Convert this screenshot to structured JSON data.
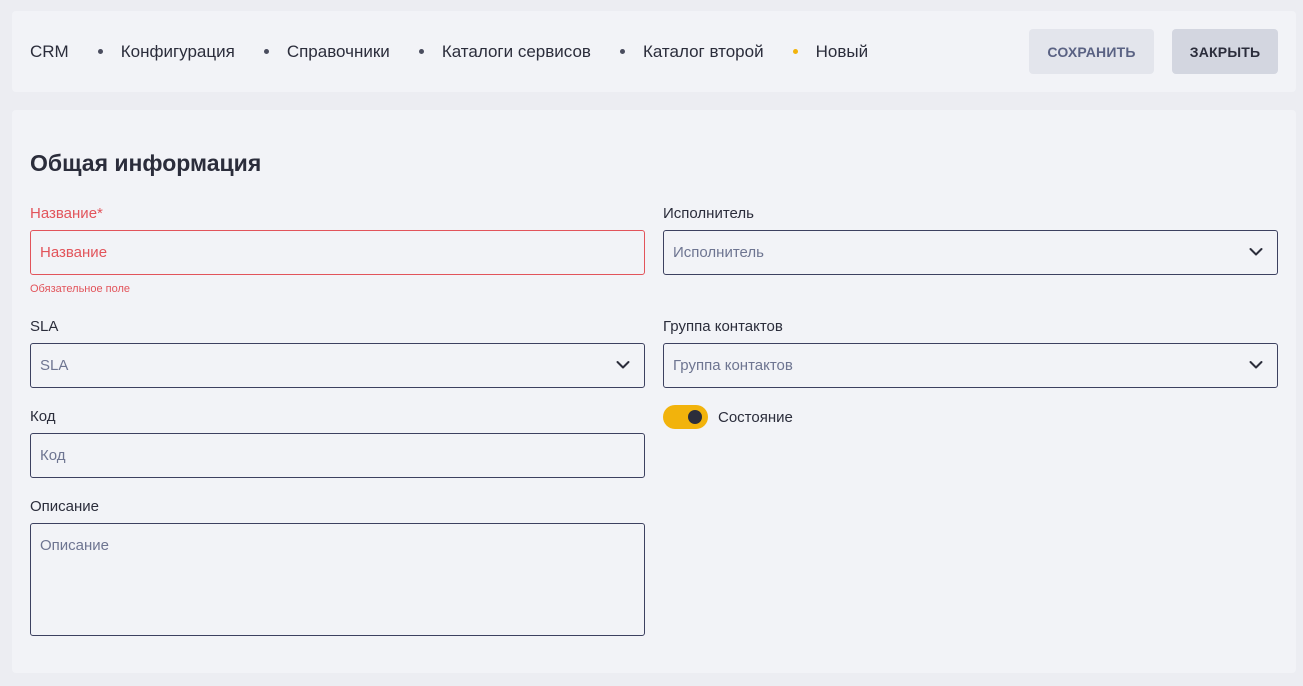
{
  "breadcrumb": {
    "items": [
      "CRM",
      "Конфигурация",
      "Справочники",
      "Каталоги сервисов",
      "Каталог второй",
      "Новый"
    ]
  },
  "toolbar": {
    "save_label": "СОХРАНИТЬ",
    "close_label": "ЗАКРЫТЬ"
  },
  "form": {
    "title": "Общая информация",
    "name": {
      "label": "Название*",
      "placeholder": "Название",
      "error": "Обязательное поле"
    },
    "executor": {
      "label": "Исполнитель",
      "placeholder": "Исполнитель"
    },
    "sla": {
      "label": "SLA",
      "placeholder": "SLA"
    },
    "contact_group": {
      "label": "Группа контактов",
      "placeholder": "Группа контактов"
    },
    "code": {
      "label": "Код",
      "placeholder": "Код"
    },
    "state": {
      "label": "Состояние",
      "enabled": true
    },
    "description": {
      "label": "Описание",
      "placeholder": "Описание"
    }
  },
  "colors": {
    "accent": "#f2b30c",
    "error": "#e2545b",
    "border": "#3d4160"
  },
  "icons": {
    "dropdown": "chevron-down-icon",
    "separator": "dot"
  }
}
